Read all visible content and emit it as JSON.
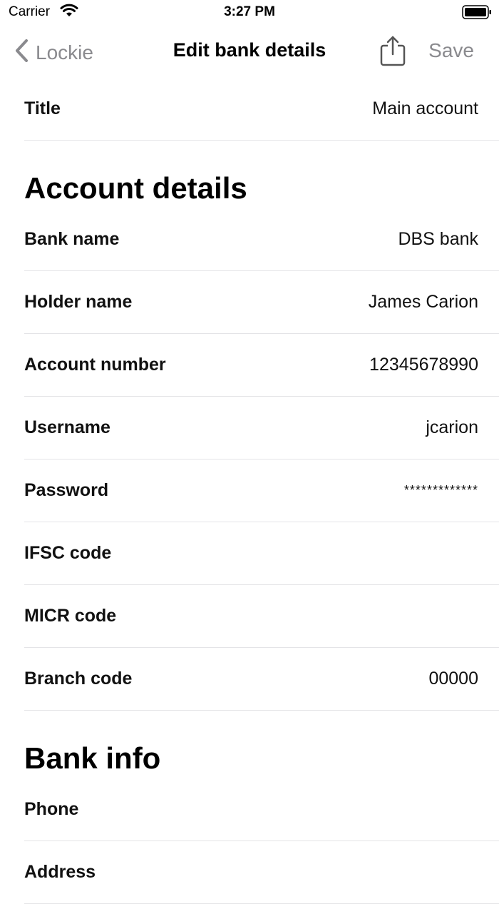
{
  "status_bar": {
    "carrier": "Carrier",
    "time": "3:27 PM"
  },
  "nav": {
    "back_label": "Lockie",
    "title": "Edit bank details",
    "save_label": "Save"
  },
  "title_row": {
    "label": "Title",
    "value": "Main account"
  },
  "account_section": {
    "header": "Account details",
    "rows": [
      {
        "label": "Bank name",
        "value": "DBS bank"
      },
      {
        "label": "Holder name",
        "value": "James Carion"
      },
      {
        "label": "Account number",
        "value": "12345678990"
      },
      {
        "label": "Username",
        "value": "jcarion"
      },
      {
        "label": "Password",
        "value": "*************"
      },
      {
        "label": "IFSC code",
        "value": ""
      },
      {
        "label": "MICR code",
        "value": ""
      },
      {
        "label": "Branch code",
        "value": "00000"
      }
    ]
  },
  "bank_info_section": {
    "header": "Bank info",
    "rows": [
      {
        "label": "Phone",
        "value": ""
      },
      {
        "label": "Address",
        "value": ""
      }
    ]
  },
  "colors": {
    "nav_gray": "#8a8a8e",
    "separator": "#e4e4e7"
  },
  "icons": {
    "back": "chevron-left-icon",
    "share": "share-icon",
    "wifi": "wifi-icon",
    "battery": "battery-icon"
  }
}
